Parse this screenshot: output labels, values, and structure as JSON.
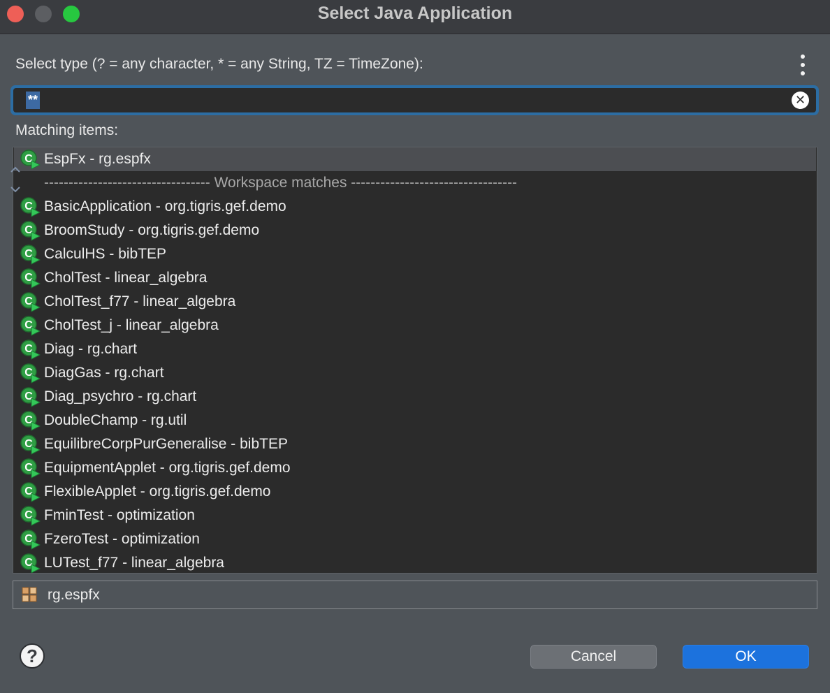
{
  "window": {
    "title": "Select Java Application"
  },
  "search": {
    "label": "Select type (? = any character, * = any String, TZ = TimeZone):",
    "value": "**",
    "clear_symbol": "✕"
  },
  "matching": {
    "label": "Matching items:"
  },
  "list": {
    "selected_item": "EspFx - rg.espfx",
    "separator": "---------------------------------- Workspace matches ----------------------------------",
    "items": [
      "BasicApplication - org.tigris.gef.demo",
      "BroomStudy - org.tigris.gef.demo",
      "CalculHS - bibTEP",
      "CholTest - linear_algebra",
      "CholTest_f77 - linear_algebra",
      "CholTest_j - linear_algebra",
      "Diag - rg.chart",
      "DiagGas - rg.chart",
      "Diag_psychro - rg.chart",
      "DoubleChamp - rg.util",
      "EquilibreCorpPurGeneralise - bibTEP",
      "EquipmentApplet - org.tigris.gef.demo",
      "FlexibleApplet - org.tigris.gef.demo",
      "FminTest - optimization",
      "FzeroTest - optimization",
      "LUTest_f77 - linear_algebra"
    ]
  },
  "package": {
    "label": "rg.espfx"
  },
  "buttons": {
    "help": "?",
    "cancel": "Cancel",
    "ok": "OK"
  },
  "icons": {
    "app_icon": "java-application-icon",
    "package_icon": "package-icon"
  },
  "colors": {
    "accent": "#1c72dd",
    "focus_ring": "#2c6da3",
    "icon_green": "#2f9e44"
  }
}
